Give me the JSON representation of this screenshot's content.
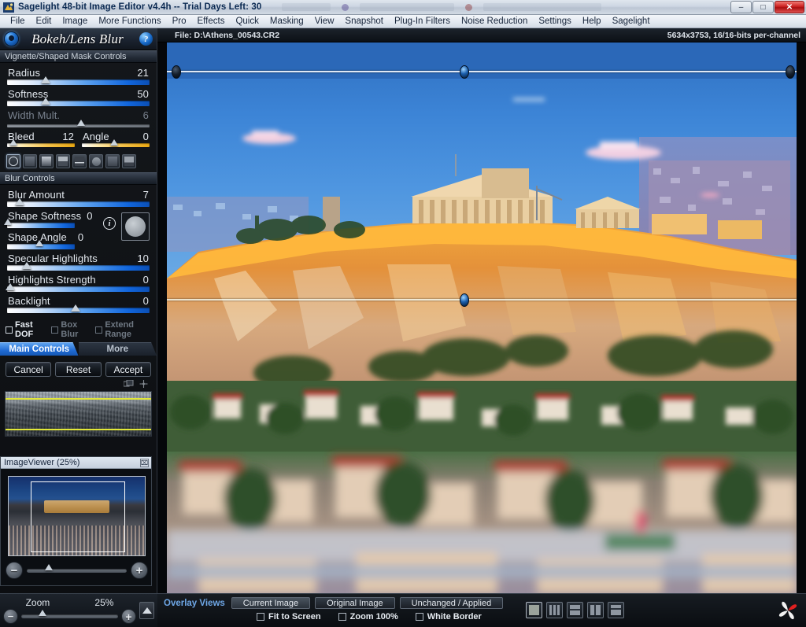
{
  "window": {
    "title": "Sagelight 48-bit Image Editor v4.4h -- Trial Days Left: 30",
    "app_name": "Sagelight 48-bit Image Editor v4.4h",
    "trial_text": "-- Trial Days Left: 30",
    "icon": "app-icon",
    "minimize_label": "–",
    "maximize_label": "□",
    "close_label": "✕"
  },
  "menu": {
    "items": [
      {
        "label": "File"
      },
      {
        "label": "Edit"
      },
      {
        "label": "Image"
      },
      {
        "label": "More Functions"
      },
      {
        "label": "Pro"
      },
      {
        "label": "Effects"
      },
      {
        "label": "Quick"
      },
      {
        "label": "Masking"
      },
      {
        "label": "View"
      },
      {
        "label": "Snapshot"
      },
      {
        "label": "Plug-In Filters"
      },
      {
        "label": "Noise Reduction"
      },
      {
        "label": "Settings"
      },
      {
        "label": "Help"
      },
      {
        "label": "Sagelight"
      }
    ]
  },
  "panel": {
    "title": "Bokeh/Lens Blur",
    "help_label": "?",
    "sections": {
      "vignette": "Vignette/Shaped Mask Controls",
      "blur": "Blur Controls"
    },
    "vignette_sliders": [
      {
        "label": "Radius",
        "value": "21",
        "pos": 27,
        "dim": false
      },
      {
        "label": "Softness",
        "value": "50",
        "pos": 27,
        "dim": false
      },
      {
        "label": "Width Mult.",
        "value": "6",
        "pos": 52,
        "dim": true
      }
    ],
    "dual_sliders": [
      {
        "label": "Bleed",
        "value": "12",
        "pos": 9
      },
      {
        "label": "Angle",
        "value": "0",
        "pos": 48
      }
    ],
    "shape_buttons": [
      {
        "name": "shape-ring",
        "selected": true
      },
      {
        "name": "shape-square",
        "selected": false
      },
      {
        "name": "shape-gradient",
        "selected": false
      },
      {
        "name": "shape-half",
        "selected": false
      },
      {
        "name": "shape-band",
        "selected": false
      },
      {
        "name": "shape-circle",
        "selected": false
      },
      {
        "name": "shape-square-soft",
        "selected": false
      },
      {
        "name": "shape-line",
        "selected": false
      }
    ],
    "blur_sliders": [
      {
        "label": "Blur Amount",
        "value": "7",
        "pos": 9
      },
      {
        "label": "Shape Softness",
        "value": "0",
        "pos": 1
      },
      {
        "label": "Shape Angle",
        "value": "0",
        "pos": 48
      },
      {
        "label": "Specular Highlights",
        "value": "10",
        "pos": 14
      },
      {
        "label": "Highlights Strength",
        "value": "0",
        "pos": 2
      },
      {
        "label": "Backlight",
        "value": "0",
        "pos": 48
      }
    ],
    "checkboxes": [
      {
        "label": "Fast DOF",
        "checked": false,
        "dim": false
      },
      {
        "label": "Box Blur",
        "checked": false,
        "dim": true
      },
      {
        "label": "Extend Range",
        "checked": false,
        "dim": true
      }
    ],
    "tabs": [
      {
        "label": "Main Controls",
        "active": true
      },
      {
        "label": "More",
        "active": false
      }
    ],
    "buttons": [
      {
        "label": "Cancel"
      },
      {
        "label": "Reset"
      },
      {
        "label": "Accept"
      }
    ]
  },
  "image_viewer": {
    "title": "ImageViewer (25%)",
    "close_label": "⌧",
    "zoom_out_label": "−",
    "zoom_in_label": "+"
  },
  "zoom_bar": {
    "label": "Zoom",
    "value": "25%",
    "minus_label": "−",
    "plus_label": "+"
  },
  "file_info": {
    "path": "File: D:\\Athens_00543.CR2",
    "specs": "5634x3753, 16/16-bits per-channel"
  },
  "bottom_bar": {
    "overlay_label": "Overlay Views",
    "overlay_tabs": [
      {
        "label": "Current Image",
        "active": true
      },
      {
        "label": "Original Image",
        "active": false
      },
      {
        "label": "Unchanged / Applied",
        "active": false
      }
    ],
    "checkboxes": [
      {
        "label": "Fit to Screen",
        "checked": false
      },
      {
        "label": "Zoom 100%",
        "checked": false
      },
      {
        "label": "White Border",
        "checked": false
      }
    ],
    "layout_buttons": [
      {
        "name": "layout-single",
        "selected": true
      },
      {
        "name": "layout-columns",
        "selected": false
      },
      {
        "name": "layout-rows",
        "selected": false
      },
      {
        "name": "layout-two-col",
        "selected": false
      },
      {
        "name": "layout-top-row",
        "selected": false
      }
    ],
    "logo": "sagelight-logo"
  },
  "colors": {
    "accent_blue": "#1f6ad2",
    "amber": "#f6c34a",
    "guide_yellow": "#e2e838",
    "panel_bg": "#0c0e11",
    "close_red": "#cc2020"
  }
}
